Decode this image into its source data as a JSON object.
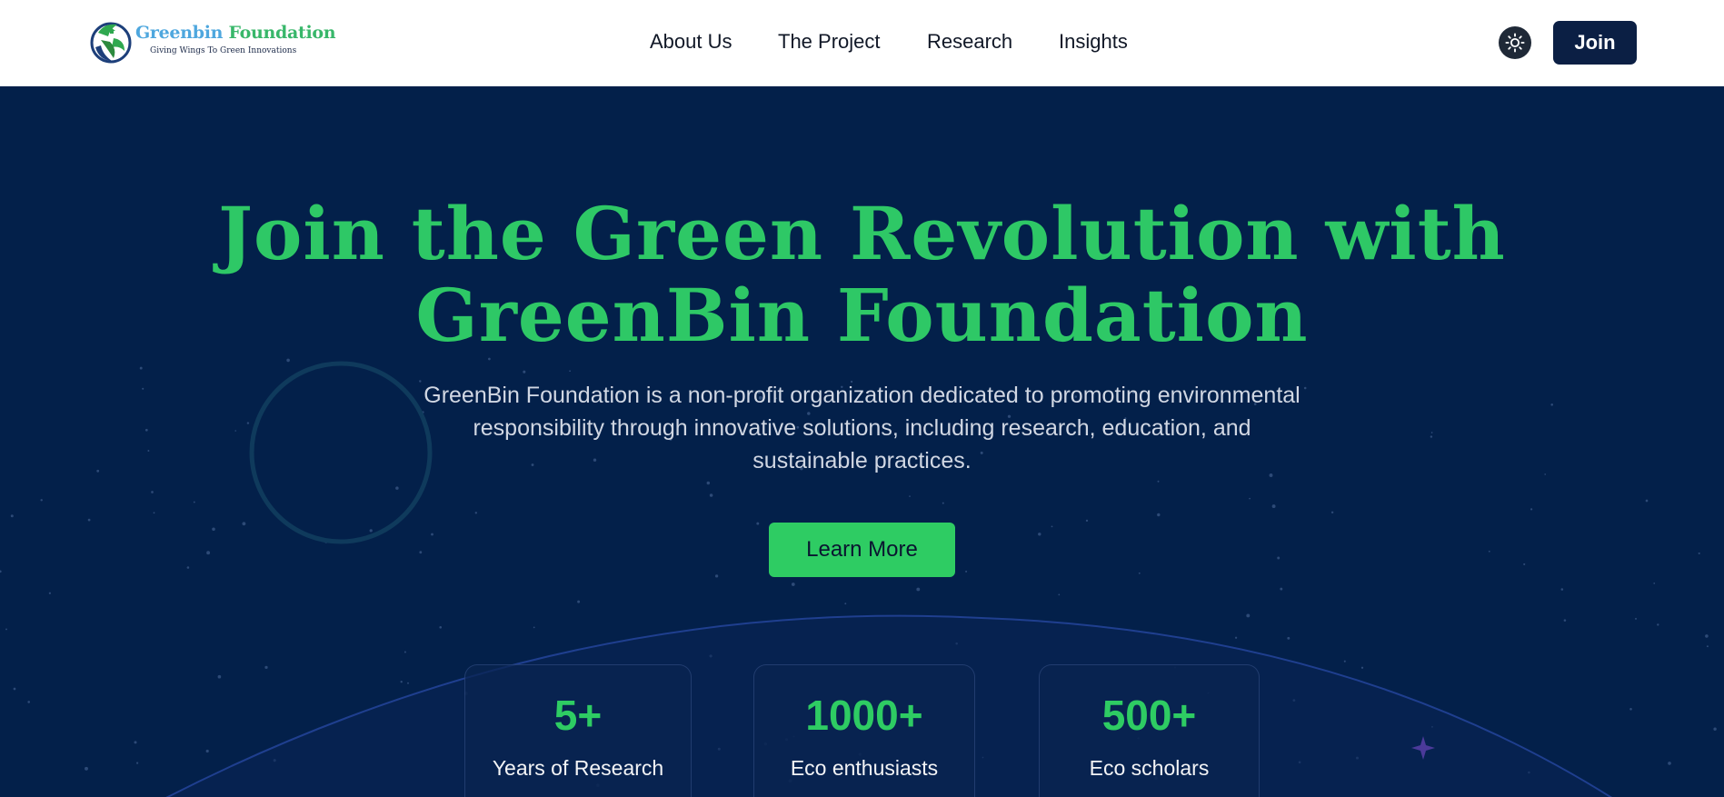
{
  "header": {
    "logo": {
      "title_part1": "Greenbin",
      "title_part2": "Foundation",
      "tagline": "Giving Wings To Green Innovations"
    },
    "nav": [
      "About Us",
      "The Project",
      "Research",
      "Insights"
    ],
    "theme_icon": "sun-icon",
    "join_label": "Join"
  },
  "hero": {
    "headline_line1": "Join the Green Revolution with",
    "headline_line2": "GreenBin Foundation",
    "description": "GreenBin Foundation is a non-profit organization dedicated to promoting environmental responsibility through innovative solutions, including research, education, and sustainable practices.",
    "cta_label": "Learn More",
    "stats": [
      {
        "value": "5+",
        "label": "Years of Research"
      },
      {
        "value": "1000+",
        "label": "Eco enthusiasts"
      },
      {
        "value": "500+",
        "label": "Eco scholars"
      }
    ]
  },
  "colors": {
    "hero_bg": "#03204a",
    "accent_green": "#2ecc63",
    "join_button": "#0b1f44"
  }
}
